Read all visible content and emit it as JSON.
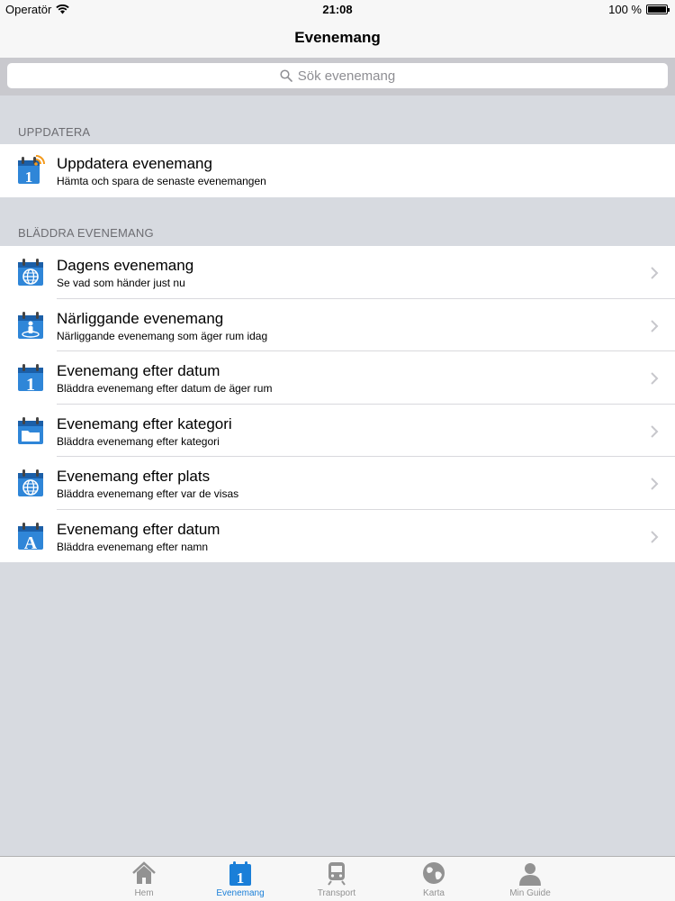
{
  "status": {
    "carrier": "Operatör",
    "time": "21:08",
    "battery": "100 %"
  },
  "nav": {
    "title": "Evenemang"
  },
  "search": {
    "placeholder": "Sök evenemang"
  },
  "sections": {
    "update": {
      "header": "UPPDATERA",
      "items": [
        {
          "title": "Uppdatera evenemang",
          "subtitle": "Hämta och spara de senaste evenemangen",
          "icon": "calendar-rss-icon"
        }
      ]
    },
    "browse": {
      "header": "BLÄDDRA EVENEMANG",
      "items": [
        {
          "title": "Dagens evenemang",
          "subtitle": "Se vad som händer just nu",
          "icon": "calendar-globe-icon"
        },
        {
          "title": "Närliggande evenemang",
          "subtitle": "Närliggande evenemang som äger rum idag",
          "icon": "calendar-person-icon"
        },
        {
          "title": "Evenemang efter datum",
          "subtitle": "Bläddra evenemang efter datum de äger rum",
          "icon": "calendar-one-icon"
        },
        {
          "title": "Evenemang efter kategori",
          "subtitle": "Bläddra evenemang efter kategori",
          "icon": "calendar-folder-icon"
        },
        {
          "title": "Evenemang efter plats",
          "subtitle": "Bläddra evenemang efter var de visas",
          "icon": "calendar-globe-icon"
        },
        {
          "title": "Evenemang efter datum",
          "subtitle": "Bläddra evenemang efter namn",
          "icon": "calendar-letter-a-icon"
        }
      ]
    }
  },
  "tabs": [
    {
      "label": "Hem",
      "icon": "home-icon",
      "active": false
    },
    {
      "label": "Evenemang",
      "icon": "calendar-icon",
      "active": true
    },
    {
      "label": "Transport",
      "icon": "train-icon",
      "active": false
    },
    {
      "label": "Karta",
      "icon": "globe-icon",
      "active": false
    },
    {
      "label": "Min Guide",
      "icon": "person-icon",
      "active": false
    }
  ],
  "colors": {
    "accent": "#1a7fd8",
    "icon_blue": "#2f86d8",
    "background": "#d7dae0",
    "rss_orange": "#f39a1c"
  }
}
